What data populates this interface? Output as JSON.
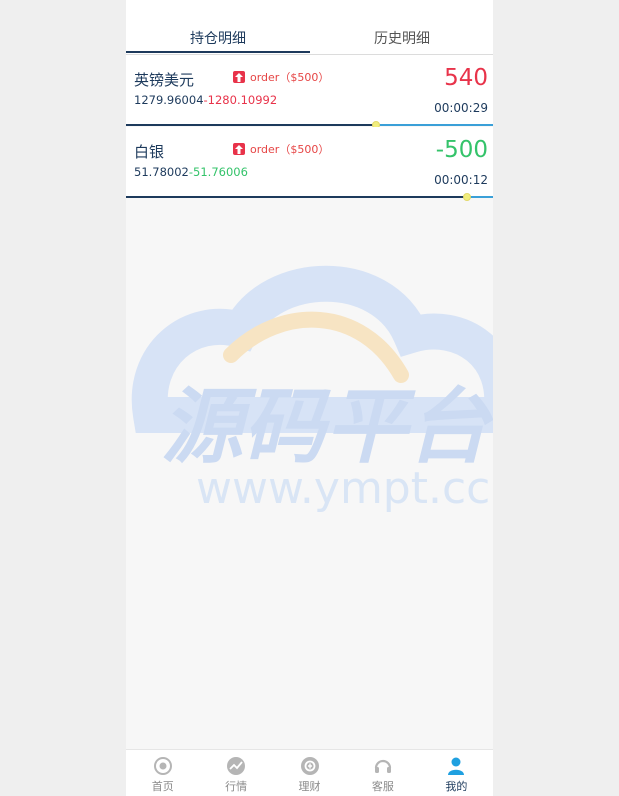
{
  "tabs": [
    {
      "label": "持仓明细",
      "active": true
    },
    {
      "label": "历史明细",
      "active": false
    }
  ],
  "positions": [
    {
      "name": "英镑美元",
      "direction_icon": "arrow-up-icon",
      "order_text": "order（$500）",
      "open_price": "1279.96004",
      "separator": "-",
      "current_price": "1280.10992",
      "profit_loss": "540",
      "time": "00:00:29",
      "progress": 0.68,
      "trend_color": "#e8334a"
    },
    {
      "name": "白银",
      "direction_icon": "arrow-up-icon",
      "order_text": "order（$500）",
      "open_price": "51.78002",
      "separator": "-",
      "current_price": "51.76006",
      "profit_loss": "-500",
      "time": "00:00:12",
      "progress": 0.93,
      "trend_color": "#34c36a"
    }
  ],
  "watermark": {
    "title": "源码平台",
    "url": "www.ympt.cc"
  },
  "nav": [
    {
      "label": "首页",
      "icon": "home-target-icon",
      "active": false
    },
    {
      "label": "行情",
      "icon": "chart-trend-icon",
      "active": false
    },
    {
      "label": "理财",
      "icon": "finance-icon",
      "active": false
    },
    {
      "label": "客服",
      "icon": "headset-icon",
      "active": false
    },
    {
      "label": "我的",
      "icon": "user-icon",
      "active": true
    }
  ],
  "colors": {
    "primary": "#1d3a5c",
    "up": "#e8334a",
    "down": "#34c36a",
    "nav_active_icon": "#1fa0e0"
  }
}
